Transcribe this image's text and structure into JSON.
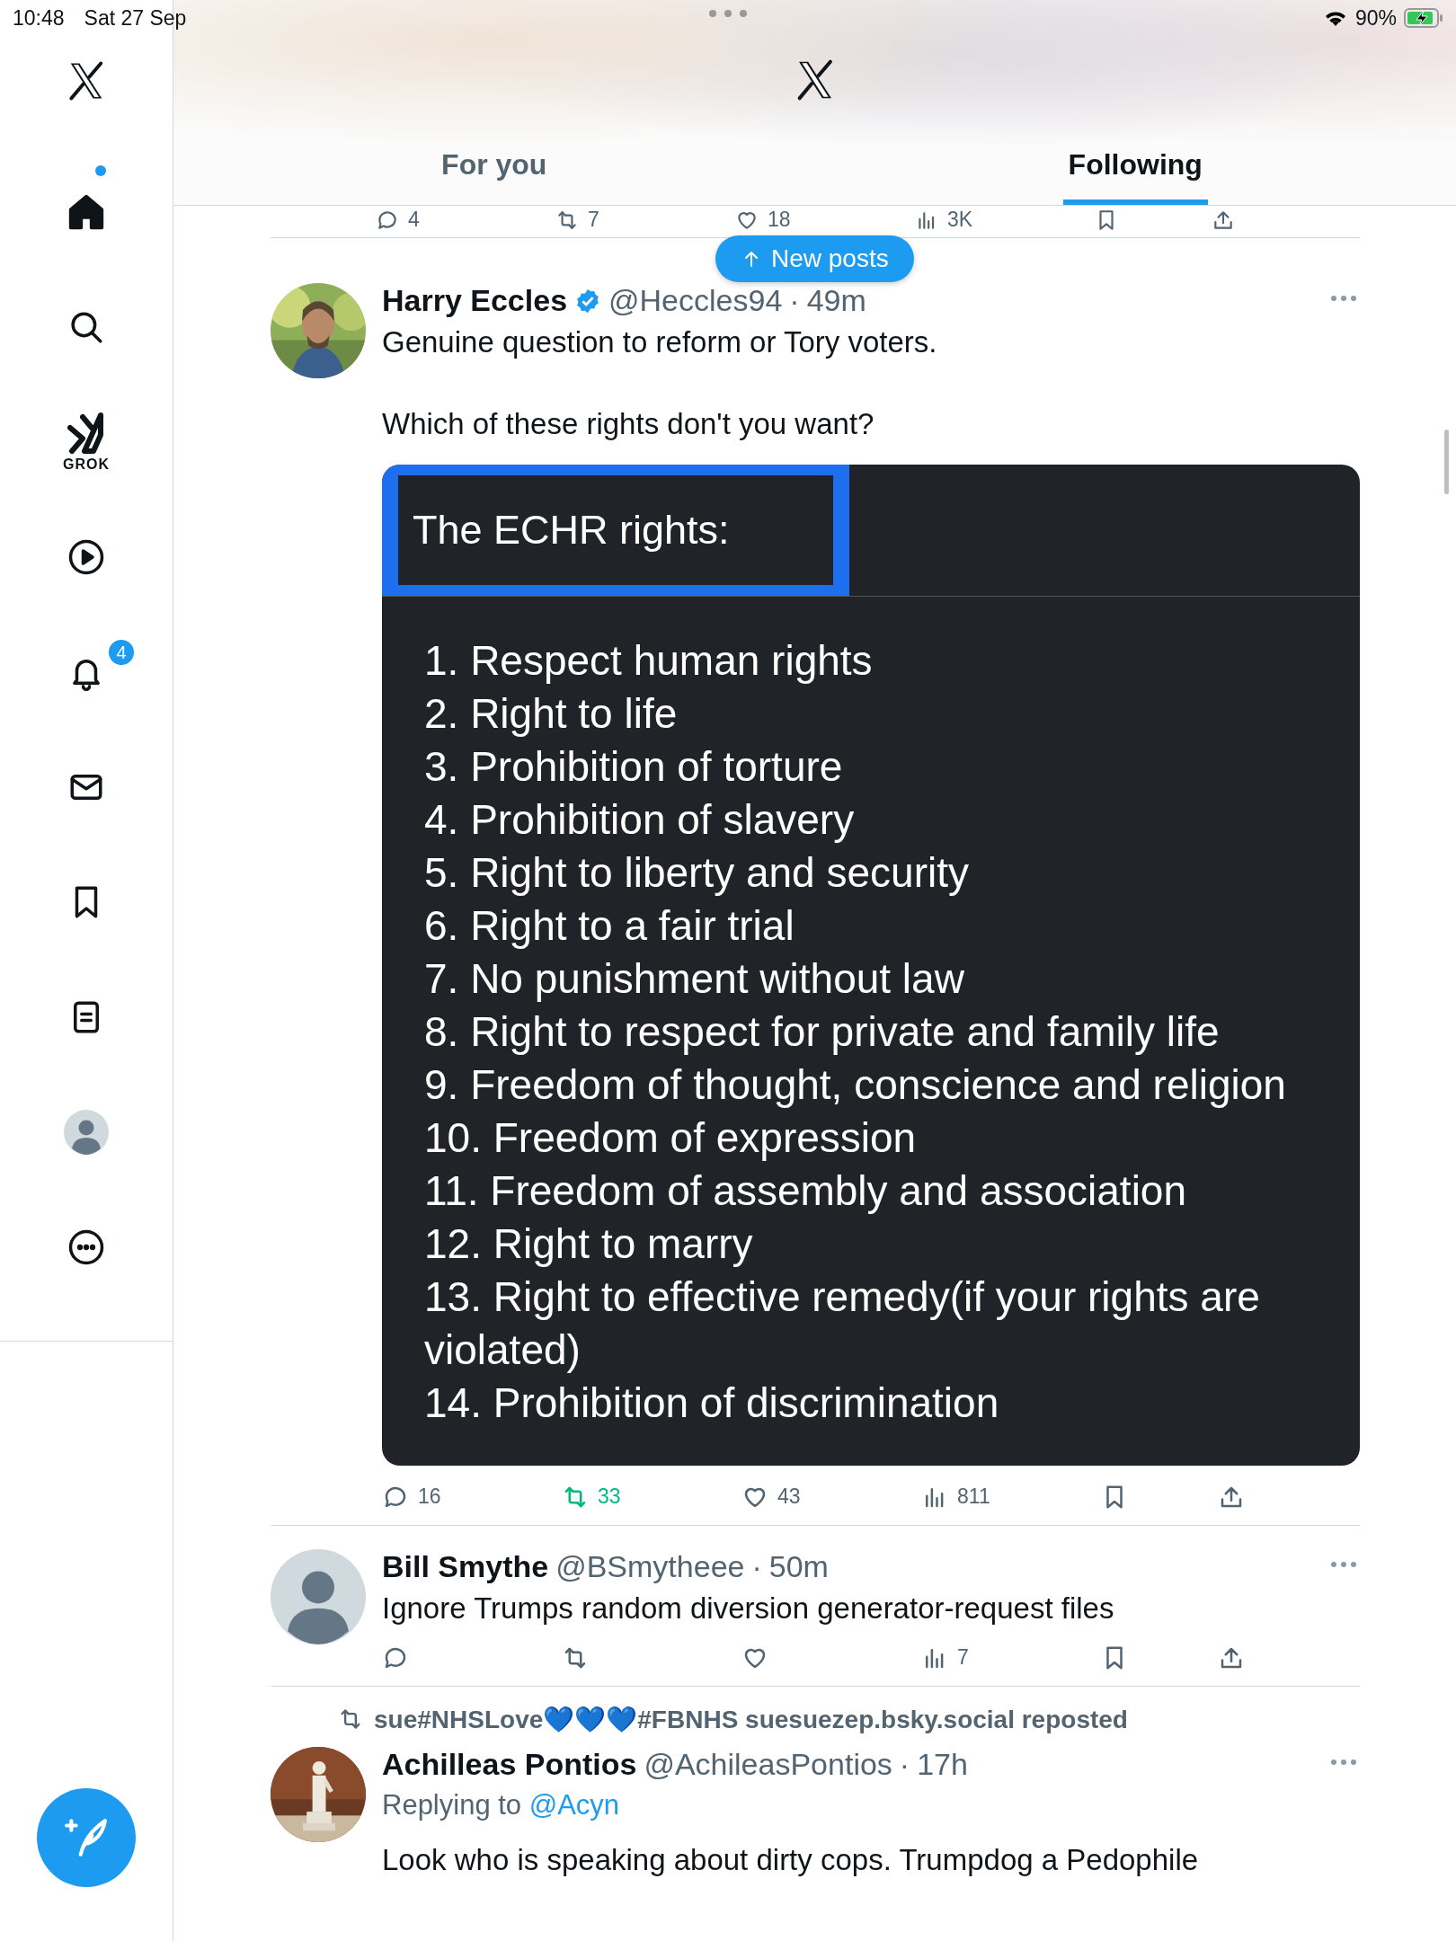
{
  "status_bar": {
    "time": "10:48",
    "date": "Sat 27 Sep",
    "battery": "90%",
    "charging": true
  },
  "sidebar": {
    "grok_label": "GROK",
    "notifications_badge": "4",
    "home_unread": true
  },
  "header": {
    "tabs": [
      {
        "label": "For you",
        "selected": false
      },
      {
        "label": "Following",
        "selected": true
      }
    ]
  },
  "new_posts_button": "New posts",
  "previous_post_actions": [
    {
      "kind": "reply",
      "count": "4",
      "active": false
    },
    {
      "kind": "repost",
      "count": "7",
      "active": false
    },
    {
      "kind": "like",
      "count": "18",
      "active": false
    },
    {
      "kind": "views",
      "count": "3K",
      "active": false
    },
    {
      "kind": "bookmark",
      "active": false
    },
    {
      "kind": "share",
      "active": false
    }
  ],
  "posts": [
    {
      "avatar": {
        "kind": "picture"
      },
      "name": "Harry Eccles",
      "verified": true,
      "handle": "@Heccles94",
      "separator": "·",
      "time": "49m",
      "text": [
        "Genuine question to reform or Tory voters.",
        "Which of these rights don't you want?"
      ],
      "image": {
        "title": "The ECHR rights:",
        "items": [
          "1. Respect human rights",
          "2. Right to life",
          "3. Prohibition of torture",
          "4. Prohibition of slavery",
          "5. Right to liberty and security",
          "6. Right to a fair trial",
          "7. No punishment without law",
          "8. Right to respect for private and family life",
          "9. Freedom of thought, conscience and religion",
          "10. Freedom of expression",
          "11. Freedom of assembly and association",
          "12. Right to marry",
          "13. Right to effective remedy(if your rights are violated)",
          "14. Prohibition of discrimination"
        ]
      },
      "actions": [
        {
          "kind": "reply",
          "count": "16",
          "active": false
        },
        {
          "kind": "repost",
          "count": "33",
          "active": true
        },
        {
          "kind": "like",
          "count": "43",
          "active": false
        },
        {
          "kind": "views",
          "count": "811",
          "active": false
        },
        {
          "kind": "bookmark",
          "active": false
        },
        {
          "kind": "share",
          "active": false
        }
      ]
    },
    {
      "avatar": {
        "kind": "default"
      },
      "name": "Bill Smythe",
      "verified": false,
      "handle": "@BSmytheee",
      "separator": "·",
      "time": "50m",
      "text": [
        "Ignore Trumps random diversion generator-request files"
      ],
      "actions": [
        {
          "kind": "reply",
          "active": false
        },
        {
          "kind": "repost",
          "active": false
        },
        {
          "kind": "like",
          "active": false
        },
        {
          "kind": "views",
          "count": "7",
          "active": false
        },
        {
          "kind": "bookmark",
          "active": false
        },
        {
          "kind": "share",
          "active": false
        }
      ]
    },
    {
      "reposted_by": "sue#NHSLove💙💙💙#FBNHS suesuezep.bsky.social reposted",
      "avatar": {
        "kind": "picture"
      },
      "name": "Achilleas Pontios",
      "verified": false,
      "handle": "@AchileasPontios",
      "separator": "·",
      "time": "17h",
      "replying_label": "Replying to",
      "replying_to": "@Acyn",
      "text": [
        "Look who is speaking about dirty cops. Trumpdog a Pedophile"
      ]
    }
  ]
}
